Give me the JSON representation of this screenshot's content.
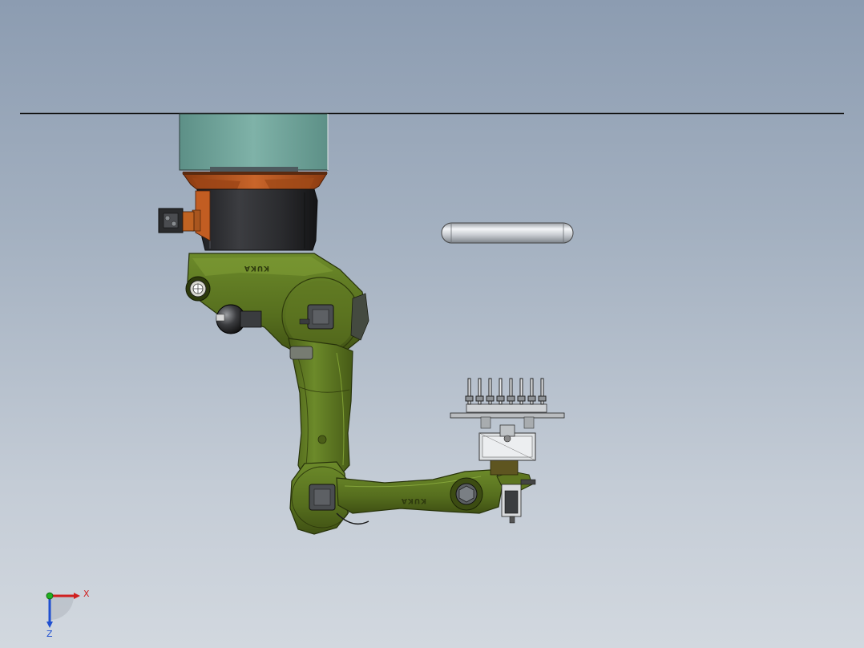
{
  "viewport": {
    "background_top": "#8c9cb1",
    "background_bottom": "#d2d8df"
  },
  "robot": {
    "brand_upper": "KUKA",
    "brand_lower": "KUKA",
    "body_color": "#5e7620",
    "body_dark": "#3c4c12",
    "body_light": "#7d9a34",
    "flange_color": "#b5531e",
    "motor_color": "#2f3033",
    "mount_color": "#6fa39a"
  },
  "triad": {
    "x_label": "X",
    "z_label": "Z",
    "x_color": "#d02020",
    "y_color": "#20b020",
    "z_color": "#2050d0"
  }
}
